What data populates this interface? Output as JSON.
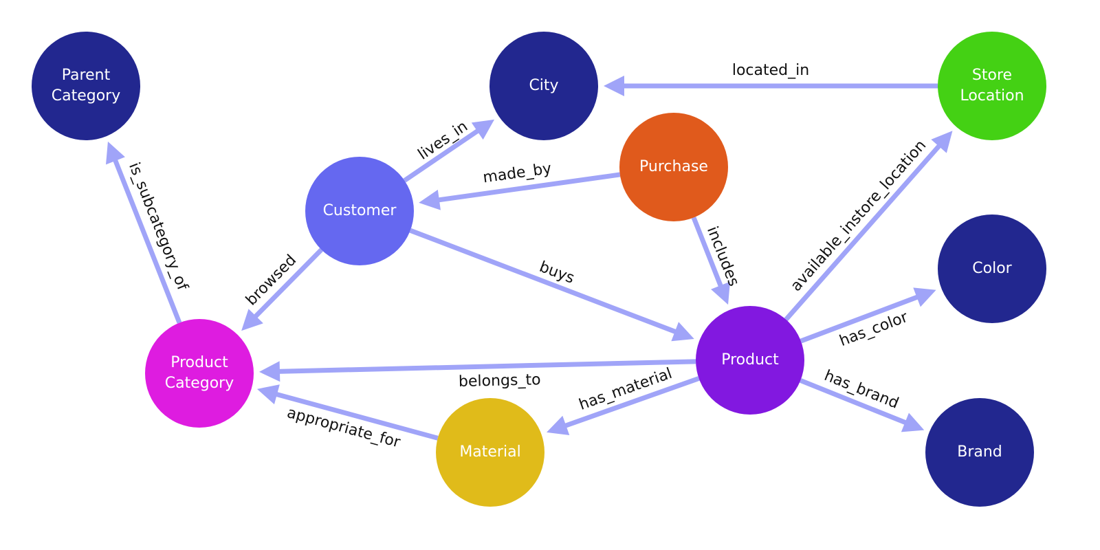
{
  "diagram": {
    "edge_color": "#a0a4f8",
    "nodes": [
      {
        "id": "parent_category",
        "lines": [
          "Parent",
          "Category"
        ],
        "color": "#22278f"
      },
      {
        "id": "city",
        "lines": [
          "City"
        ],
        "color": "#22278f"
      },
      {
        "id": "store_location",
        "lines": [
          "Store",
          "Location"
        ],
        "color": "#44d114"
      },
      {
        "id": "purchase",
        "lines": [
          "Purchase"
        ],
        "color": "#e05a1c"
      },
      {
        "id": "customer",
        "lines": [
          "Customer"
        ],
        "color": "#6568f0"
      },
      {
        "id": "color",
        "lines": [
          "Color"
        ],
        "color": "#22278f"
      },
      {
        "id": "product",
        "lines": [
          "Product"
        ],
        "color": "#8218e0"
      },
      {
        "id": "product_category",
        "lines": [
          "Product",
          "Category"
        ],
        "color": "#de1ce0"
      },
      {
        "id": "material",
        "lines": [
          "Material"
        ],
        "color": "#e0bb1a"
      },
      {
        "id": "brand",
        "lines": [
          "Brand"
        ],
        "color": "#22278f"
      }
    ],
    "edges": [
      {
        "from": "store_location",
        "to": "city",
        "label": "located_in"
      },
      {
        "from": "customer",
        "to": "city",
        "label": "lives_in"
      },
      {
        "from": "purchase",
        "to": "customer",
        "label": "made_by"
      },
      {
        "from": "purchase",
        "to": "product",
        "label": "includes"
      },
      {
        "from": "customer",
        "to": "product",
        "label": "buys"
      },
      {
        "from": "customer",
        "to": "product_category",
        "label": "browsed"
      },
      {
        "from": "product_category",
        "to": "parent_category",
        "label": "is_subcategory_of"
      },
      {
        "from": "product",
        "to": "store_location",
        "label": "available_instore_location"
      },
      {
        "from": "product",
        "to": "color",
        "label": "has_color"
      },
      {
        "from": "product",
        "to": "brand",
        "label": "has_brand"
      },
      {
        "from": "product",
        "to": "product_category",
        "label": "belongs_to"
      },
      {
        "from": "product",
        "to": "material",
        "label": "has_material"
      },
      {
        "from": "material",
        "to": "product_category",
        "label": "appropriate_for"
      }
    ]
  }
}
